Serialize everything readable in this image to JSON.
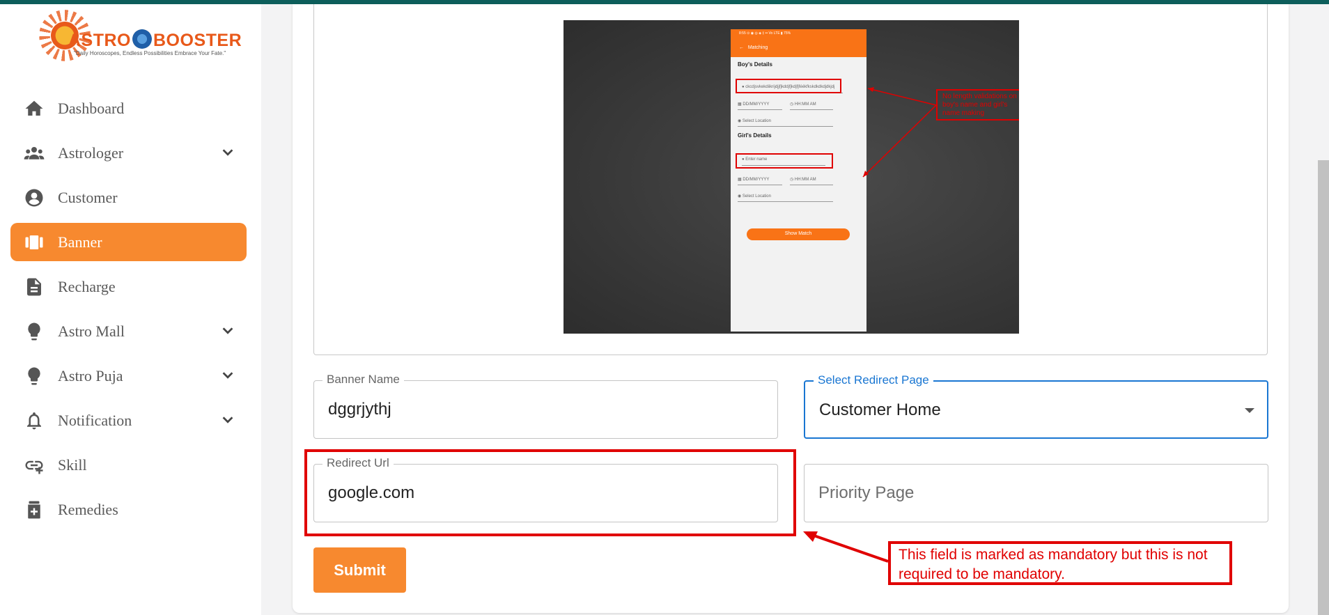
{
  "brand": {
    "name_left": "ASTRO",
    "name_right": "BOOSTER",
    "tagline": "\"Daily Horoscopes, Endless Possibilities Embrace Your Fate.\""
  },
  "sidebar": {
    "items": [
      {
        "label": "Dashboard",
        "icon": "home-icon",
        "expandable": false,
        "active": false
      },
      {
        "label": "Astrologer",
        "icon": "users-icon",
        "expandable": true,
        "active": false
      },
      {
        "label": "Customer",
        "icon": "user-circle-icon",
        "expandable": false,
        "active": false
      },
      {
        "label": "Banner",
        "icon": "banner-icon",
        "expandable": false,
        "active": true
      },
      {
        "label": "Recharge",
        "icon": "document-icon",
        "expandable": false,
        "active": false
      },
      {
        "label": "Astro Mall",
        "icon": "bulb-icon",
        "expandable": true,
        "active": false
      },
      {
        "label": "Astro Puja",
        "icon": "bulb-icon",
        "expandable": true,
        "active": false
      },
      {
        "label": "Notification",
        "icon": "bell-icon",
        "expandable": true,
        "active": false
      },
      {
        "label": "Skill",
        "icon": "link-icon",
        "expandable": false,
        "active": false
      },
      {
        "label": "Remedies",
        "icon": "medicine-icon",
        "expandable": false,
        "active": false
      }
    ]
  },
  "preview": {
    "phone": {
      "status": "8:55    ⊙ ◉         ◎ ◈ ‡ •• Vo LTE ▮ 75%",
      "title": "Matching",
      "boys_section": "Boy's Details",
      "boys_name_value": "ckcdjsvkekdiikrijdjjfjkddjfjkdjfjféékfkskdkdkdjdkjdj",
      "date_placeholder": "DD/MM/YYYY",
      "time_placeholder": "HH:MM AM",
      "location_placeholder": "Select Location",
      "girls_section": "Girl's Details",
      "girls_name_placeholder": "Enter name",
      "button": "Show Match"
    },
    "note": "No length validations on boy's name and girl's name making"
  },
  "form": {
    "banner_name": {
      "label": "Banner Name",
      "value": "dggrjythj"
    },
    "redirect_page": {
      "label": "Select Redirect Page",
      "value": "Customer Home"
    },
    "redirect_url": {
      "label": "Redirect Url",
      "value": "google.com"
    },
    "priority_page": {
      "placeholder": "Priority Page"
    },
    "submit_label": "Submit"
  },
  "annotation": {
    "text": "This field is marked as mandatory but this is not required to be mandatory.",
    "color": "#e00000"
  },
  "colors": {
    "accent": "#f7892f",
    "focus": "#1976d2",
    "topbar": "#0d5e5b"
  }
}
